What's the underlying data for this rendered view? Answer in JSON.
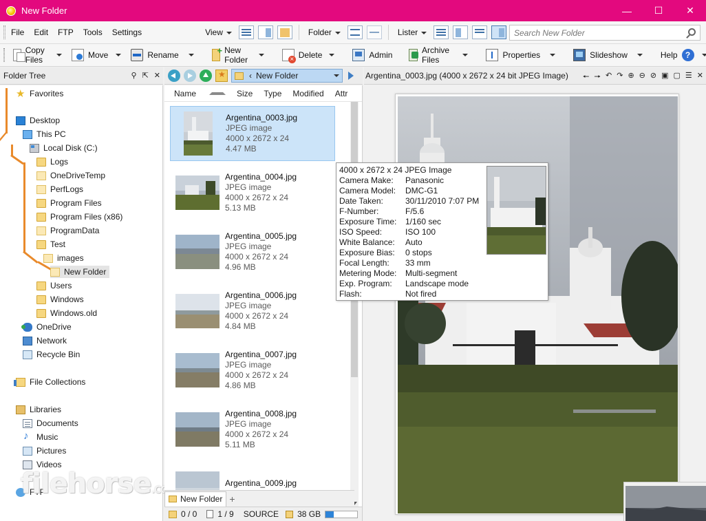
{
  "window": {
    "title": "New Folder",
    "controls": [
      "—",
      "☐",
      "✕"
    ]
  },
  "menu": {
    "items": [
      "File",
      "Edit",
      "FTP",
      "Tools",
      "Settings"
    ],
    "view_label": "View",
    "folder_label": "Folder",
    "lister_label": "Lister",
    "search_placeholder": "Search New Folder"
  },
  "toolbar": {
    "copy": "Copy Files",
    "move": "Move",
    "rename": "Rename",
    "new_folder": "New Folder",
    "delete": "Delete",
    "admin": "Admin",
    "archive": "Archive Files",
    "properties": "Properties",
    "slideshow": "Slideshow",
    "help": "Help"
  },
  "tree": {
    "header": "Folder Tree",
    "items": [
      "Favorites",
      "Desktop",
      "This PC",
      "Local Disk (C:)",
      "Logs",
      "OneDriveTemp",
      "PerfLogs",
      "Program Files",
      "Program Files (x86)",
      "ProgramData",
      "Test",
      "images",
      "New Folder",
      "Users",
      "Windows",
      "Windows.old",
      "OneDrive",
      "Network",
      "Recycle Bin",
      "File Collections",
      "Libraries",
      "Documents",
      "Music",
      "Pictures",
      "Videos",
      "FTP"
    ]
  },
  "files": {
    "path_chevron": "‹",
    "path": "New Folder",
    "columns": [
      "Name",
      "Size",
      "Type",
      "Modified",
      "Attr"
    ],
    "items": [
      {
        "name": "Argentina_0003.jpg",
        "type": "JPEG image",
        "dims": "4000 x 2672 x 24",
        "size": "4.47 MB"
      },
      {
        "name": "Argentina_0004.jpg",
        "type": "JPEG image",
        "dims": "4000 x 2672 x 24",
        "size": "5.13 MB"
      },
      {
        "name": "Argentina_0005.jpg",
        "type": "JPEG image",
        "dims": "4000 x 2672 x 24",
        "size": "4.96 MB"
      },
      {
        "name": "Argentina_0006.jpg",
        "type": "JPEG image",
        "dims": "4000 x 2672 x 24",
        "size": "4.84 MB"
      },
      {
        "name": "Argentina_0007.jpg",
        "type": "JPEG image",
        "dims": "4000 x 2672 x 24",
        "size": "4.86 MB"
      },
      {
        "name": "Argentina_0008.jpg",
        "type": "JPEG image",
        "dims": "4000 x 2672 x 24",
        "size": "5.11 MB"
      },
      {
        "name": "Argentina_0009.jpg",
        "type": "JPEG image",
        "dims": "",
        "size": ""
      }
    ],
    "tab_label": "New Folder",
    "tab_add": "+",
    "status": {
      "folders": "0 / 0",
      "files": "1 / 9",
      "source": "SOURCE",
      "free": "38 GB",
      "free_fill_fraction": 0.25
    }
  },
  "tooltip": {
    "header": "4000 x 2672 x 24 JPEG Image",
    "rows": [
      {
        "k": "Camera Make:",
        "v": "Panasonic"
      },
      {
        "k": "Camera Model:",
        "v": "DMC-G1"
      },
      {
        "k": "Date Taken:",
        "v": "30/11/2010 7:07 PM"
      },
      {
        "k": "F-Number:",
        "v": "F/5.6"
      },
      {
        "k": "Exposure Time:",
        "v": "1/160 sec"
      },
      {
        "k": "ISO Speed:",
        "v": "ISO 100"
      },
      {
        "k": "White Balance:",
        "v": "Auto"
      },
      {
        "k": "Exposure Bias:",
        "v": "0 stops"
      },
      {
        "k": "Focal Length:",
        "v": "33 mm"
      },
      {
        "k": "Metering Mode:",
        "v": "Multi-segment"
      },
      {
        "k": "Exp. Program:",
        "v": "Landscape mode"
      },
      {
        "k": "Flash:",
        "v": "Not fired"
      }
    ]
  },
  "viewer": {
    "title": "Argentina_0003.jpg (4000 x 2672 x 24 bit JPEG Image)"
  },
  "watermark": {
    "text": "filehorse",
    "suffix": ".com"
  },
  "colors": {
    "titlebar": "#e3097e",
    "selection": "#cce4f9",
    "tree_line": "#e98a2b"
  }
}
